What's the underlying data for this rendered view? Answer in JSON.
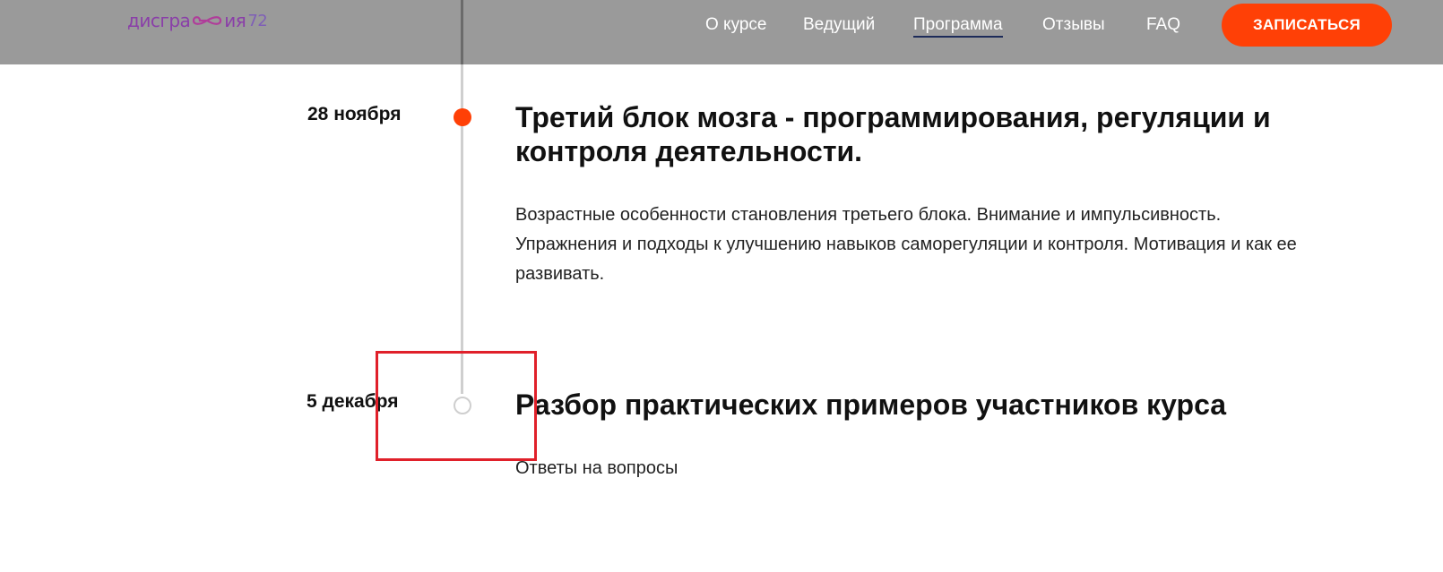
{
  "header": {
    "logo": {
      "main_left": "дисгра",
      "main_right": "ия",
      "number": "72",
      "icon": "infinity-icon"
    },
    "nav": [
      {
        "label": "О курсе",
        "active": false
      },
      {
        "label": "Ведущий",
        "active": false
      },
      {
        "label": "Программа",
        "active": true
      },
      {
        "label": "Отзывы",
        "active": false
      },
      {
        "label": "FAQ",
        "active": false
      }
    ],
    "cta_label": "ЗАПИСАТЬСЯ"
  },
  "timeline": [
    {
      "date": "28 ноября",
      "title": "Третий блок мозга - программирования, регуляции и контроля деятельности.",
      "description": "Возрастные особенности становления третьего блока. Внимание и импульсивность. Упражнения и подходы к улучшению навыков саморегуляции и контроля. Мотивация и как ее развивать.",
      "dot": "filled"
    },
    {
      "date": "5 декабря",
      "title": "Разбор практических примеров участников курса",
      "description": "Ответы на вопросы",
      "dot": "empty"
    }
  ],
  "colors": {
    "accent": "#ff4006",
    "header_bg": "#9a9a9a",
    "logo": "#8a3fa8",
    "highlight": "#e0202a"
  }
}
